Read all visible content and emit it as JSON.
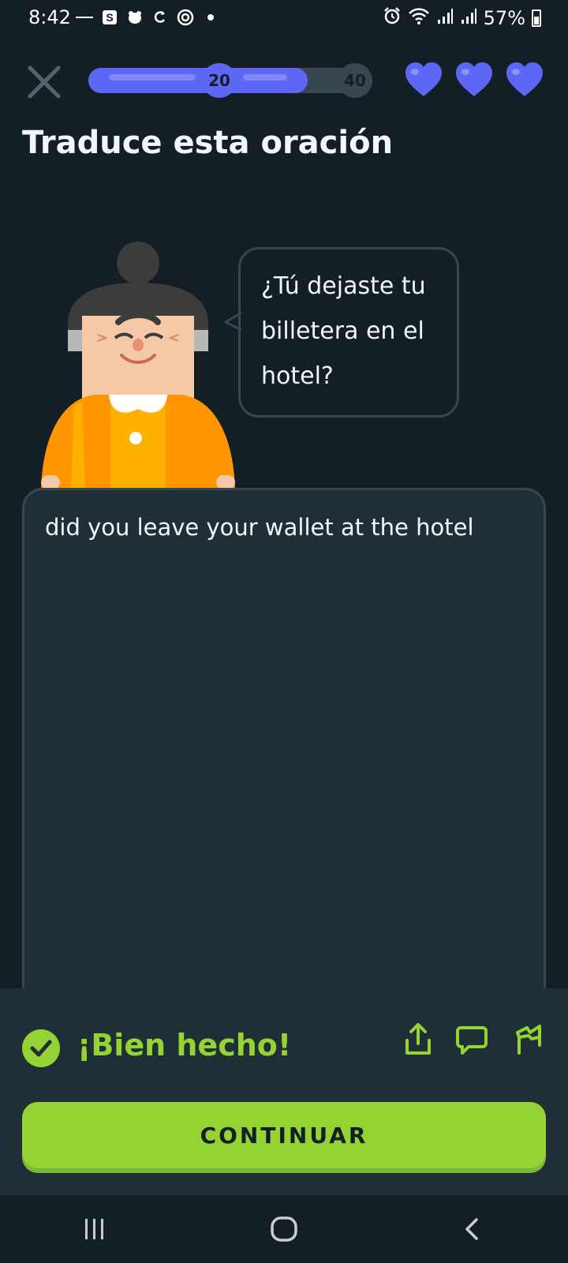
{
  "status_bar": {
    "time": "8:42",
    "battery": "57%",
    "notification_icons": [
      "minus-icon",
      "s-app-icon",
      "bird-icon",
      "sync-icon",
      "target-icon",
      "dot-icon"
    ],
    "system_icons": [
      "alarm-icon",
      "wifi-icon",
      "signal-icon",
      "signal-icon",
      "battery-icon"
    ]
  },
  "header": {
    "close_icon": "close-icon",
    "progress": {
      "value": 0.78,
      "milestones": [
        {
          "label": "20",
          "reached": true
        },
        {
          "label": "40",
          "reached": false
        }
      ]
    },
    "hearts": {
      "count": 3,
      "color": "#5d66f5"
    }
  },
  "exercise": {
    "title": "Traduce esta oración",
    "prompt": "¿Tú dejaste tu billetera en el hotel?",
    "answer": "did you leave your wallet at the hotel"
  },
  "feedback": {
    "title": "¡Bien hecho!",
    "icons": [
      "share-icon",
      "comment-icon",
      "report-flag-icon"
    ],
    "accent": "#93d333",
    "continue_label": "CONTINUAR"
  },
  "navbar": {
    "buttons": [
      "recent-apps-icon",
      "home-icon",
      "back-icon"
    ]
  }
}
